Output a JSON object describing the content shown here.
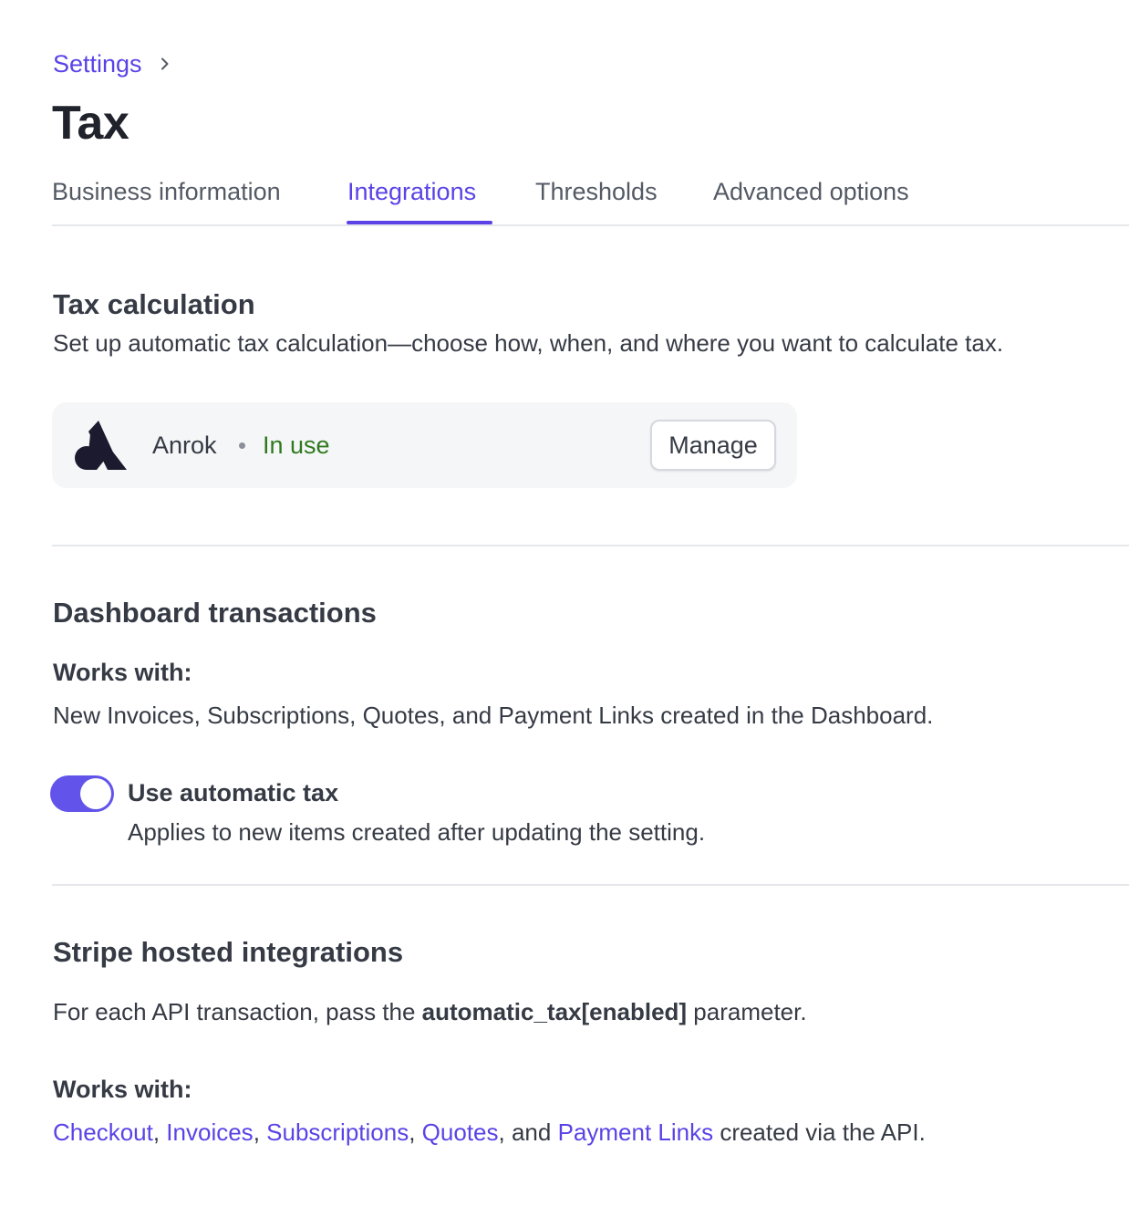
{
  "breadcrumb": {
    "label": "Settings"
  },
  "page": {
    "title": "Tax"
  },
  "tabs": [
    {
      "label": "Business information",
      "active": false
    },
    {
      "label": "Integrations",
      "active": true
    },
    {
      "label": "Thresholds",
      "active": false
    },
    {
      "label": "Advanced options",
      "active": false
    }
  ],
  "tax_calculation": {
    "title": "Tax calculation",
    "description": "Set up automatic tax calculation—choose how, when, and where you want to calculate tax.",
    "integration": {
      "logo_icon": "anrok-logo-icon",
      "name": "Anrok",
      "separator": "•",
      "status": "In use",
      "status_color": "#2f7a1f",
      "manage_label": "Manage"
    }
  },
  "dashboard_transactions": {
    "title": "Dashboard transactions",
    "works_with_label": "Works with:",
    "works_with_text": "New Invoices, Subscriptions, Quotes, and Payment Links created in the Dashboard.",
    "toggle": {
      "label": "Use automatic tax",
      "description": "Applies to new items created after updating the setting.",
      "enabled": true
    }
  },
  "stripe_hosted": {
    "title": "Stripe hosted integrations",
    "desc_prefix": "For each API transaction, pass the ",
    "desc_param": "automatic_tax[enabled]",
    "desc_suffix": " parameter.",
    "works_with_label": "Works with:",
    "links": [
      "Checkout",
      "Invoices",
      "Subscriptions",
      "Quotes",
      "Payment Links"
    ],
    "separator_comma": ", ",
    "separator_and": ", and ",
    "links_suffix": " created via the API."
  },
  "colors": {
    "accent": "#5a43e6",
    "toggle_on": "#6254ea",
    "text": "#353a44",
    "status_green": "#2f7a1f",
    "card_bg": "#f5f6f8"
  }
}
